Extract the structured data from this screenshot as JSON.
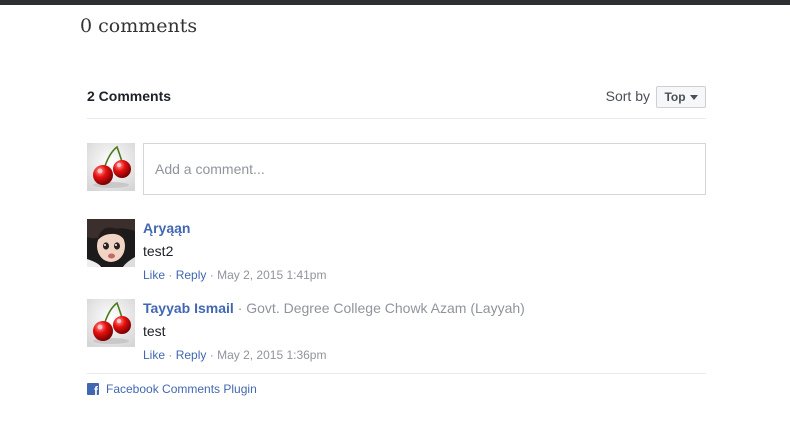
{
  "post": {
    "comment_count_label": "0 comments"
  },
  "plugin": {
    "header": {
      "count_label": "2 Comments",
      "sort_label": "Sort by",
      "sort_value": "Top"
    },
    "composer": {
      "placeholder": "Add a comment..."
    },
    "comments": [
      {
        "author": "Ąryąąn",
        "affiliation": "",
        "text": "test2",
        "like": "Like",
        "reply": "Reply",
        "timestamp": "May 2, 2015 1:41pm",
        "avatar": "child-photo-avatar"
      },
      {
        "author": "Tayyab Ismail",
        "affiliation": "Govt. Degree College Chowk Azam (Layyah)",
        "text": "test",
        "like": "Like",
        "reply": "Reply",
        "timestamp": "May 2, 2015 1:36pm",
        "avatar": "cherries-avatar"
      }
    ],
    "footer": {
      "link": "Facebook Comments Plugin"
    }
  },
  "colors": {
    "link_blue": "#4267b2",
    "meta_gray": "#90949c",
    "text_dark": "#1d2129",
    "divider": "#e9ebee",
    "top_bar": "#2d2f31"
  }
}
